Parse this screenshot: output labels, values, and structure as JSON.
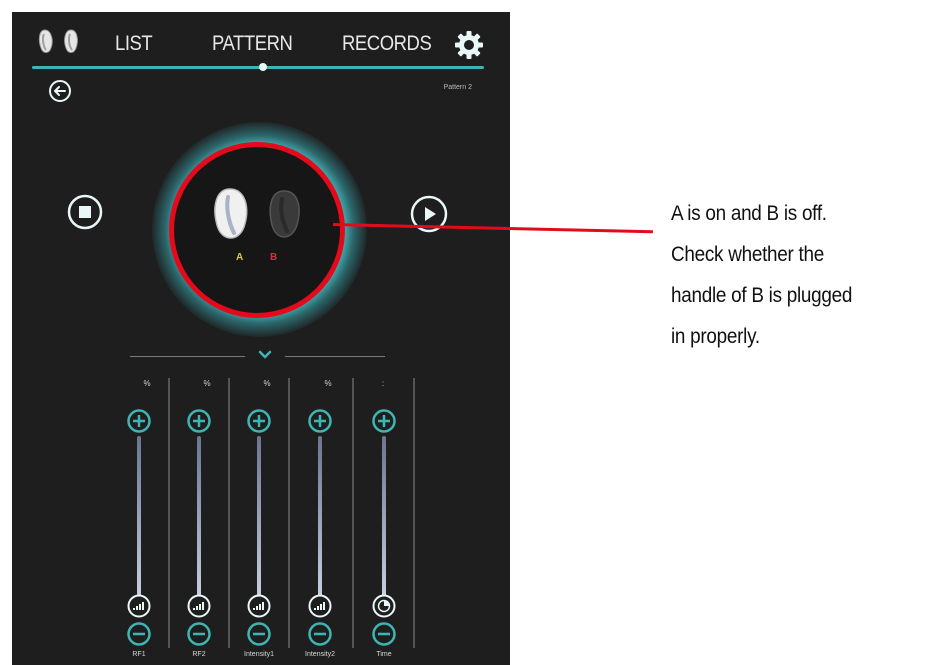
{
  "app": {
    "nav": {
      "list": "LIST",
      "pattern": "PATTERN",
      "records": "RECORDS",
      "active": "pattern"
    },
    "pattern_name": "Pattern 2",
    "device": {
      "handle_a_label": "A",
      "handle_b_label": "B",
      "handle_a_state": "on",
      "handle_b_state": "off"
    },
    "sliders": [
      {
        "label": "RF1",
        "unit": "%"
      },
      {
        "label": "RF2",
        "unit": "%"
      },
      {
        "label": "Intensity1",
        "unit": "%"
      },
      {
        "label": "Intensity2",
        "unit": "%"
      },
      {
        "label": "Time",
        "unit": ":"
      }
    ],
    "colors": {
      "accent": "#3fb5b3",
      "highlight": "#e30b1b",
      "background": "#1e1e1e"
    }
  },
  "annotation": {
    "lines": [
      "A is on and B is off.",
      "Check whether the",
      "handle of B is plugged",
      "in properly."
    ]
  },
  "icons": [
    "handles-logo-icon",
    "gear-icon",
    "back-arrow-icon",
    "stop-icon",
    "play-icon",
    "chevron-down-icon",
    "plus-icon",
    "minus-icon",
    "signal-icon",
    "clock-icon"
  ]
}
